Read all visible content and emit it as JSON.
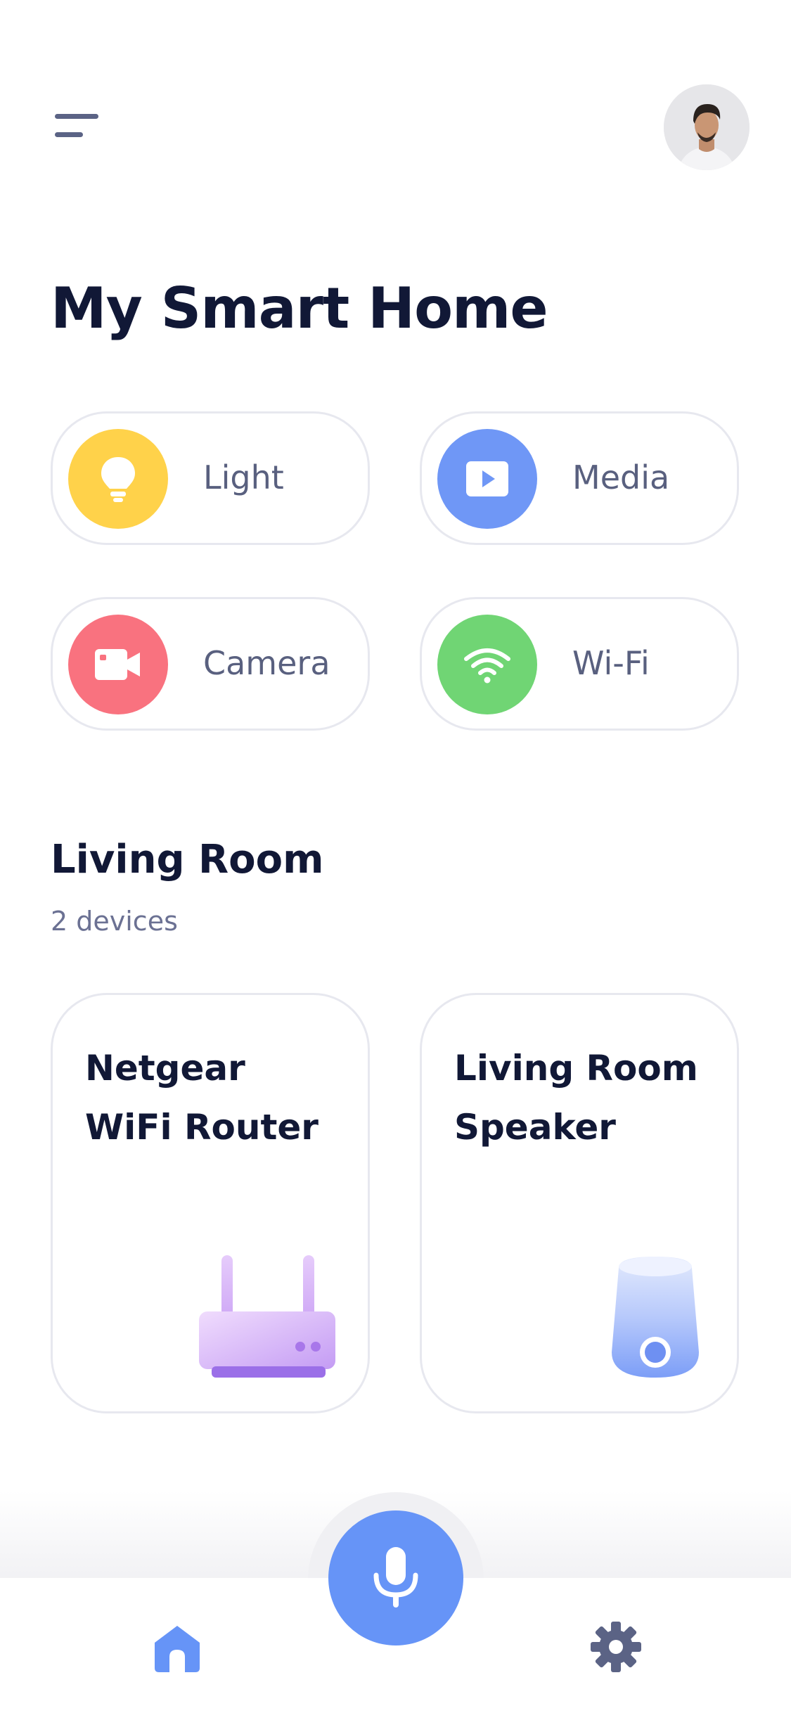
{
  "header": {
    "title": "My Smart Home",
    "menu_icon": "hamburger-menu-icon",
    "avatar": "user-avatar"
  },
  "categories": [
    {
      "label": "Light",
      "icon": "lightbulb-icon",
      "color": "#ffd24a"
    },
    {
      "label": "Media",
      "icon": "play-icon",
      "color": "#6f97f6"
    },
    {
      "label": "Camera",
      "icon": "video-camera-icon",
      "color": "#f9727f"
    },
    {
      "label": "Wi-Fi",
      "icon": "wifi-icon",
      "color": "#70d574"
    }
  ],
  "room": {
    "title": "Living Room",
    "subtitle": "2 devices",
    "devices": [
      {
        "name_line1": "Netgear",
        "name_line2": "WiFi Router",
        "icon": "router-icon"
      },
      {
        "name_line1": "Living Room",
        "name_line2": "Speaker",
        "icon": "smart-speaker-icon"
      }
    ]
  },
  "bottom_nav": {
    "home_icon": "home-icon",
    "mic_icon": "microphone-icon",
    "settings_icon": "gear-icon",
    "accent": "#6694f7",
    "inactive": "#5b6385"
  }
}
